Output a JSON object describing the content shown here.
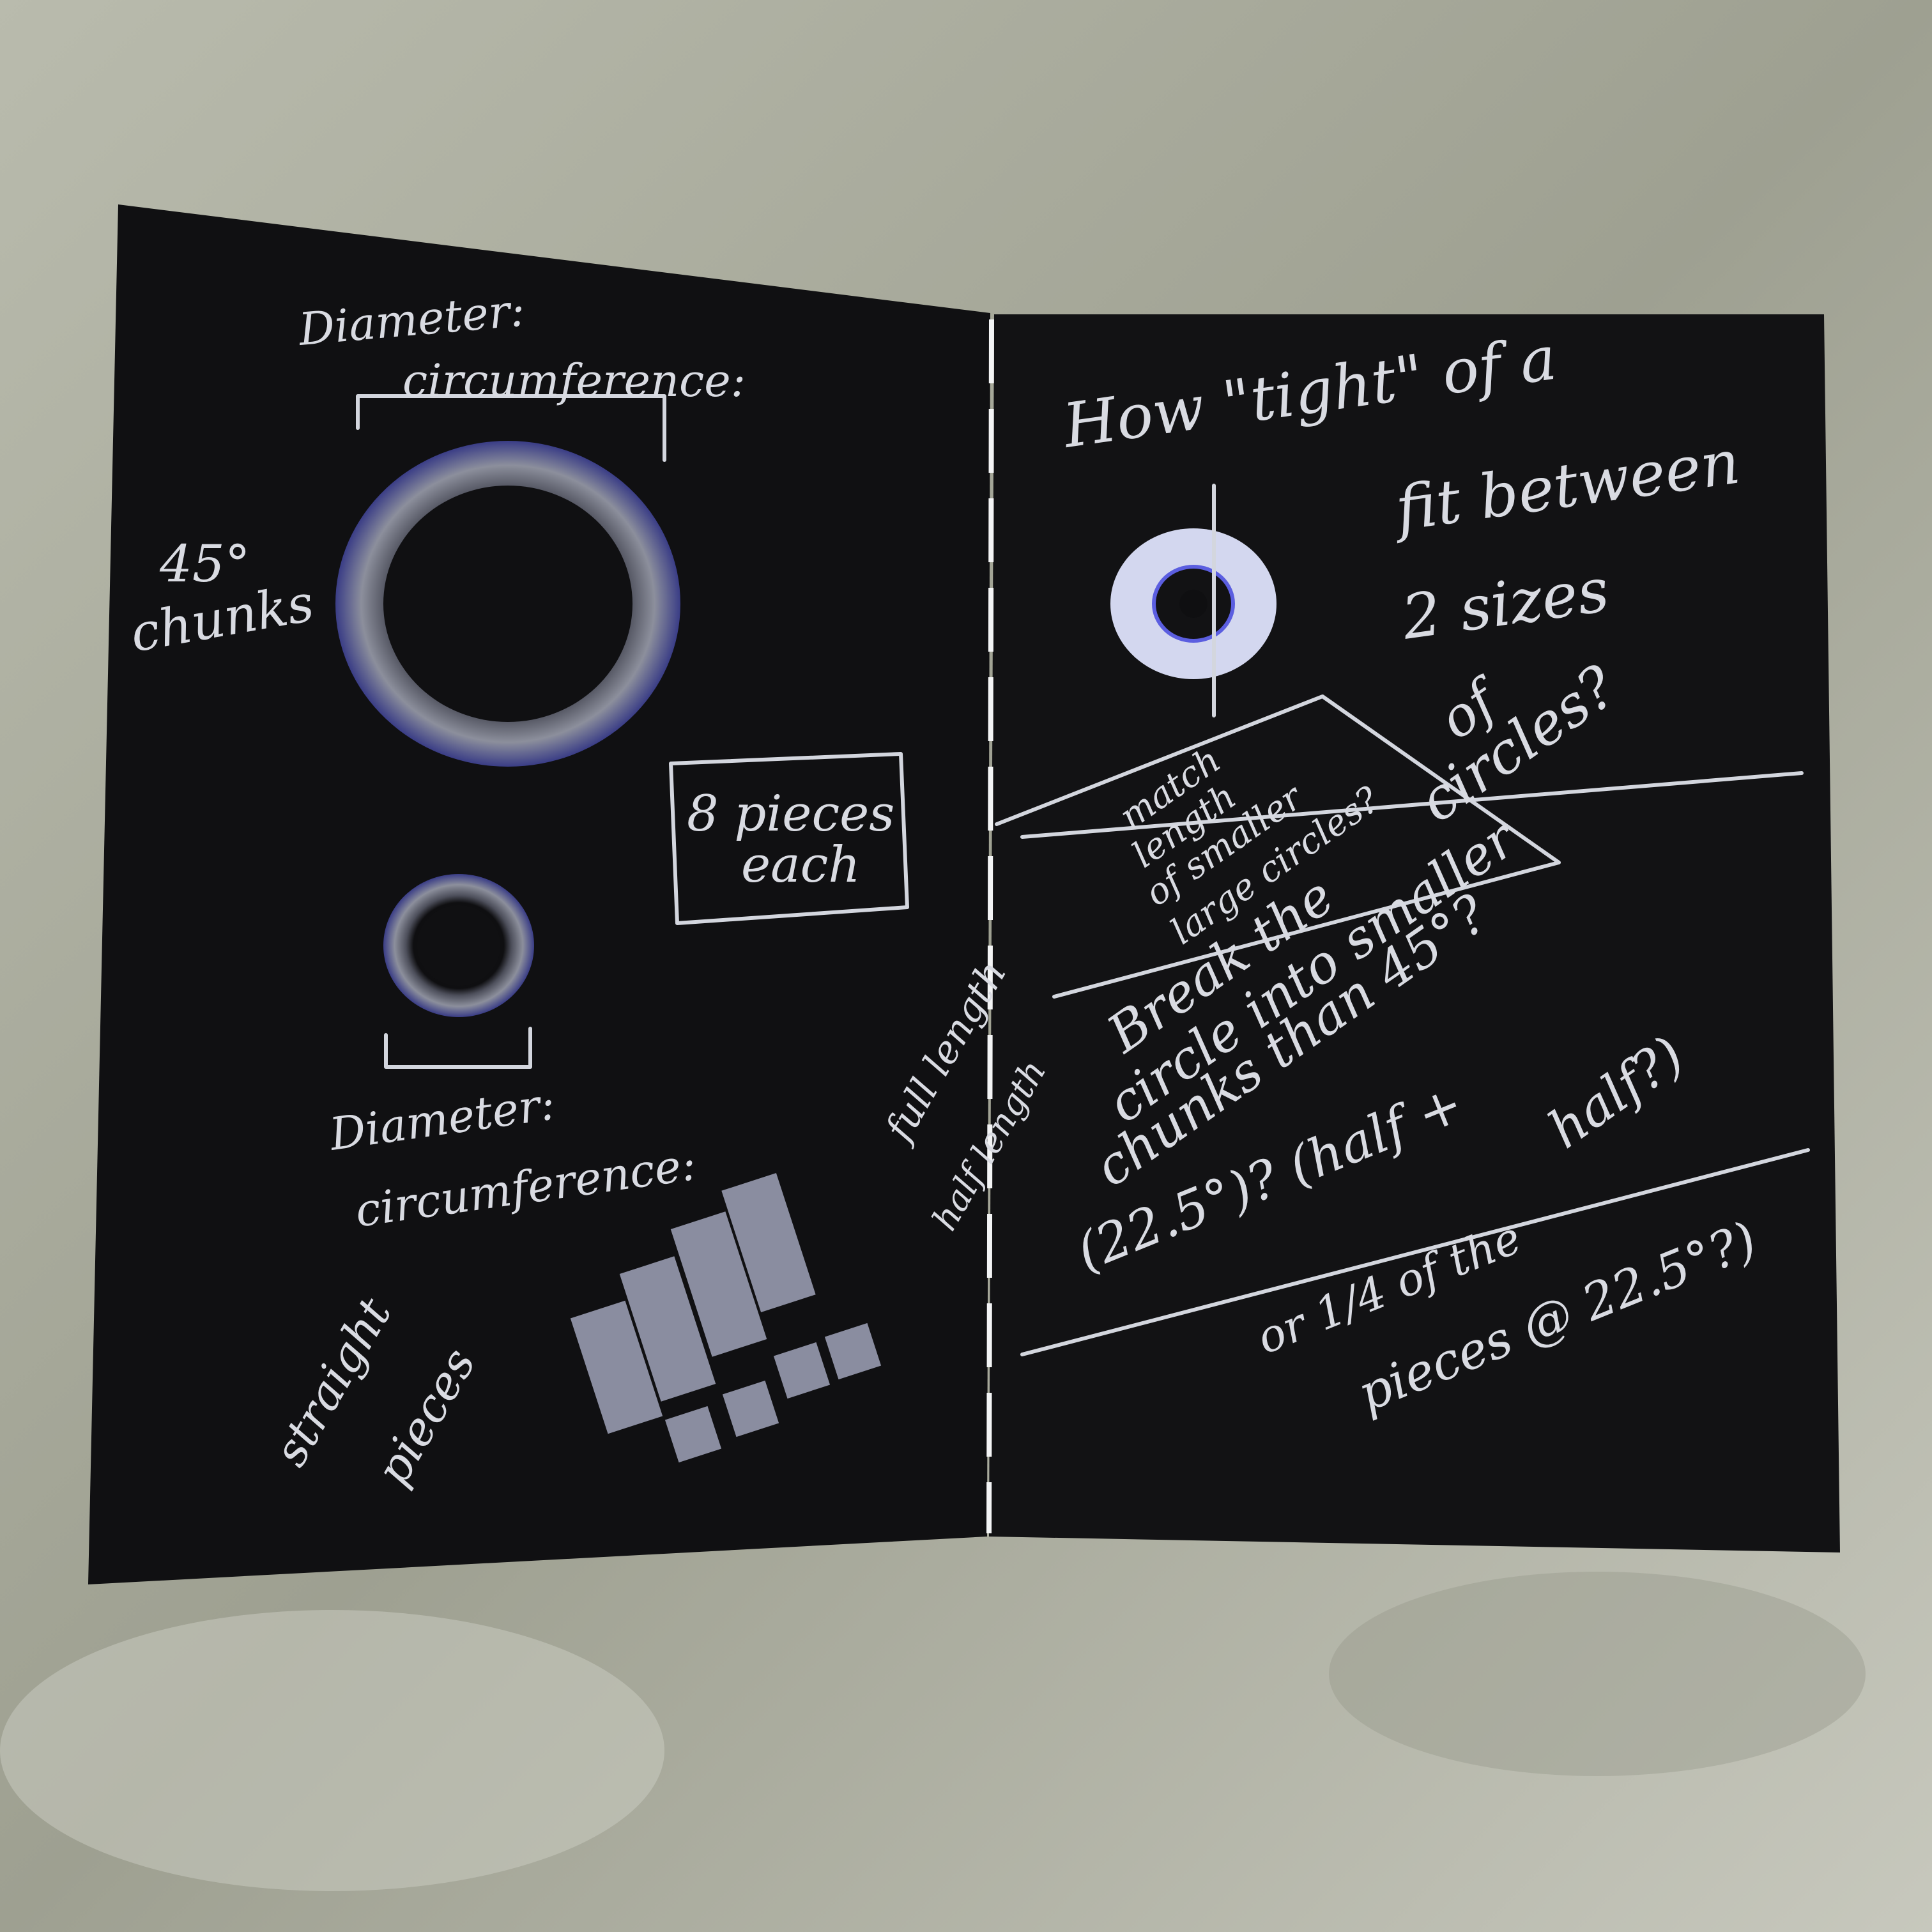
{
  "left_page": {
    "top_label_1": "Diameter:",
    "top_label_2": "circumference:",
    "chunks_label_1": "45°",
    "chunks_label_2": "chunks",
    "pieces_label_1": "8 pieces",
    "pieces_label_2": "each",
    "bottom_label_1": "Diameter:",
    "bottom_label_2": "circumference:",
    "straight_label_1": "straight",
    "straight_label_2": "pieces",
    "full_length": "full length",
    "half_length": "half length"
  },
  "right_page": {
    "question_1": "How \"tight\" of a",
    "question_2": "fit between",
    "question_3": "2 sizes",
    "question_4": "of",
    "question_5": "circles?",
    "match_1": "match",
    "match_2": "length",
    "match_3": "of smaller",
    "match_4": "large circles?",
    "break_1": "Break the",
    "break_2": "circle into smaller",
    "break_3": "chunks than 45°?",
    "break_4": "(22.5°)? (half +",
    "break_5": "half?)",
    "or_1": "or 1/4 of the",
    "or_2": "pieces @ 22.5°?)"
  },
  "colors": {
    "paper": "#0f0f11",
    "chalk": "#d9dbe2",
    "accent_blue": "#5b5ee0",
    "background": "#a9ab9c"
  }
}
